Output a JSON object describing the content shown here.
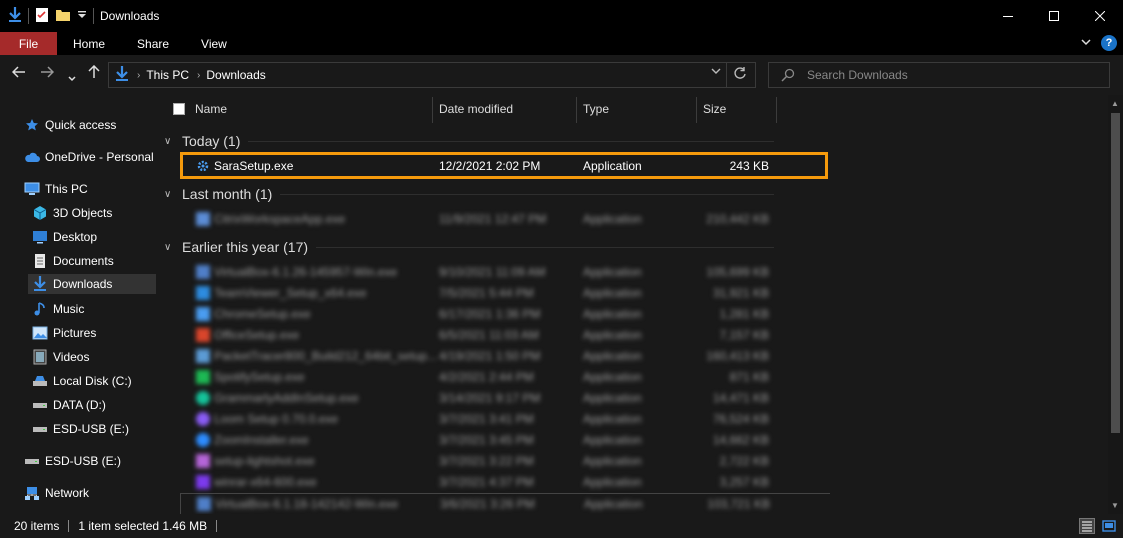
{
  "window": {
    "title": "Downloads"
  },
  "ribbon": {
    "tabs": [
      "File",
      "Home",
      "Share",
      "View"
    ]
  },
  "address": {
    "crumbs": [
      "This PC",
      "Downloads"
    ]
  },
  "search": {
    "placeholder": "Search Downloads"
  },
  "nav": {
    "items": [
      {
        "label": "Quick access",
        "icon": "star-icon"
      },
      {
        "label": "OneDrive - Personal",
        "icon": "cloud-icon"
      },
      {
        "label": "This PC",
        "icon": "computer-icon"
      },
      {
        "label": "3D Objects",
        "icon": "cube-icon"
      },
      {
        "label": "Desktop",
        "icon": "desktop-icon"
      },
      {
        "label": "Documents",
        "icon": "document-icon"
      },
      {
        "label": "Downloads",
        "icon": "download-icon"
      },
      {
        "label": "Music",
        "icon": "music-icon"
      },
      {
        "label": "Pictures",
        "icon": "picture-icon"
      },
      {
        "label": "Videos",
        "icon": "video-icon"
      },
      {
        "label": "Local Disk (C:)",
        "icon": "disk-icon"
      },
      {
        "label": "DATA (D:)",
        "icon": "drive-icon"
      },
      {
        "label": "ESD-USB (E:)",
        "icon": "usb-drive-icon"
      },
      {
        "label": "ESD-USB (E:)",
        "icon": "usb-drive-icon"
      },
      {
        "label": "Network",
        "icon": "network-icon"
      }
    ]
  },
  "columns": {
    "name": "Name",
    "date": "Date modified",
    "type": "Type",
    "size": "Size"
  },
  "groups": {
    "today": "Today (1)",
    "last_month": "Last month (1)",
    "earlier": "Earlier this year (17)"
  },
  "files": {
    "selected": {
      "name": "SaraSetup.exe",
      "date": "12/2/2021 2:02 PM",
      "type": "Application",
      "size": "243 KB"
    },
    "last_month": [
      {
        "name": "CitrixWorkspaceApp.exe",
        "date": "11/9/2021 12:47 PM",
        "type": "Application",
        "size": "210,442 KB"
      }
    ],
    "earlier": [
      {
        "name": "VirtualBox-6.1.26-145957-Win.exe",
        "date": "9/10/2021 11:09 AM",
        "type": "Application",
        "size": "105,699 KB"
      },
      {
        "name": "TeamViewer_Setup_x64.exe",
        "date": "7/5/2021 5:44 PM",
        "type": "Application",
        "size": "31,921 KB"
      },
      {
        "name": "ChromeSetup.exe",
        "date": "6/17/2021 1:36 PM",
        "type": "Application",
        "size": "1,281 KB"
      },
      {
        "name": "OfficeSetup.exe",
        "date": "6/5/2021 11:03 AM",
        "type": "Application",
        "size": "7,157 KB"
      },
      {
        "name": "PacketTracer800_Build212_64bit_setup...",
        "date": "4/19/2021 1:50 PM",
        "type": "Application",
        "size": "160,413 KB"
      },
      {
        "name": "SpotifySetup.exe",
        "date": "4/2/2021 2:44 PM",
        "type": "Application",
        "size": "871 KB"
      },
      {
        "name": "GrammarlyAddInSetup.exe",
        "date": "3/14/2021 9:17 PM",
        "type": "Application",
        "size": "14,471 KB"
      },
      {
        "name": "Loom Setup 0.70.0.exe",
        "date": "3/7/2021 3:41 PM",
        "type": "Application",
        "size": "76,524 KB"
      },
      {
        "name": "ZoomInstaller.exe",
        "date": "3/7/2021 3:45 PM",
        "type": "Application",
        "size": "14,662 KB"
      },
      {
        "name": "setup-lightshot.exe",
        "date": "3/7/2021 3:22 PM",
        "type": "Application",
        "size": "2,722 KB"
      },
      {
        "name": "winrar-x64-600.exe",
        "date": "3/7/2021 4:37 PM",
        "type": "Application",
        "size": "3,257 KB"
      },
      {
        "name": "VirtualBox-6.1.18-142142-Win.exe",
        "date": "3/6/2021 3:26 PM",
        "type": "Application",
        "size": "103,721 KB"
      }
    ]
  },
  "status": {
    "count": "20 items",
    "selection": "1 item selected  1.46 MB"
  }
}
